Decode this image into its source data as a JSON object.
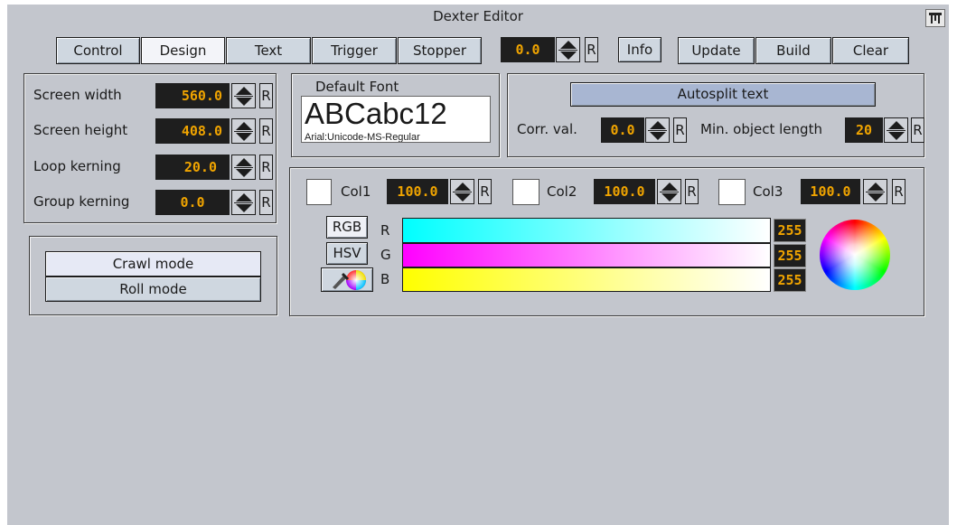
{
  "window": {
    "title": "Dexter Editor",
    "pin_icon": "pin-icon"
  },
  "tabs": [
    {
      "label": "Control",
      "active": false
    },
    {
      "label": "Design",
      "active": true
    },
    {
      "label": "Text",
      "active": false
    },
    {
      "label": "Trigger",
      "active": false
    },
    {
      "label": "Stopper",
      "active": false
    }
  ],
  "toolbar": {
    "value": "0.0",
    "reset_label": "R",
    "info_label": "Info",
    "update_label": "Update",
    "build_label": "Build",
    "clear_label": "Clear"
  },
  "screen_settings": [
    {
      "label": "Screen width",
      "value": "560.0",
      "reset": "R"
    },
    {
      "label": "Screen height",
      "value": "408.0",
      "reset": "R"
    },
    {
      "label": "Loop kerning",
      "value": "20.0",
      "reset": "R"
    },
    {
      "label": "Group kerning",
      "value": "0.0",
      "reset": "R"
    }
  ],
  "mode": {
    "crawl_label": "Crawl mode",
    "roll_label": "Roll mode",
    "selected": "Crawl mode"
  },
  "font": {
    "label": "Default Font",
    "preview_text": "ABCabc12",
    "font_name": "Arial:Unicode-MS-Regular"
  },
  "autosplit": {
    "button_label": "Autosplit text",
    "corr_label": "Corr. val.",
    "corr_value": "0.0",
    "min_length_label": "Min. object length",
    "min_length_value": "20",
    "reset": "R"
  },
  "colors": {
    "cols": [
      {
        "label": "Col1",
        "value": "100.0",
        "reset": "R",
        "swatch": "#ffffff"
      },
      {
        "label": "Col2",
        "value": "100.0",
        "reset": "R",
        "swatch": "#ffffff"
      },
      {
        "label": "Col3",
        "value": "100.0",
        "reset": "R",
        "swatch": "#ffffff"
      }
    ],
    "rgb_label": "RGB",
    "hsv_label": "HSV",
    "picker_icon": "eyedropper-icon",
    "channels": [
      {
        "label": "R",
        "value": "255",
        "color": "#00ffff"
      },
      {
        "label": "G",
        "value": "255",
        "color": "#ff00ff"
      },
      {
        "label": "B",
        "value": "255",
        "color": "#ffff00"
      }
    ],
    "wheel_icon": "color-wheel-icon"
  }
}
